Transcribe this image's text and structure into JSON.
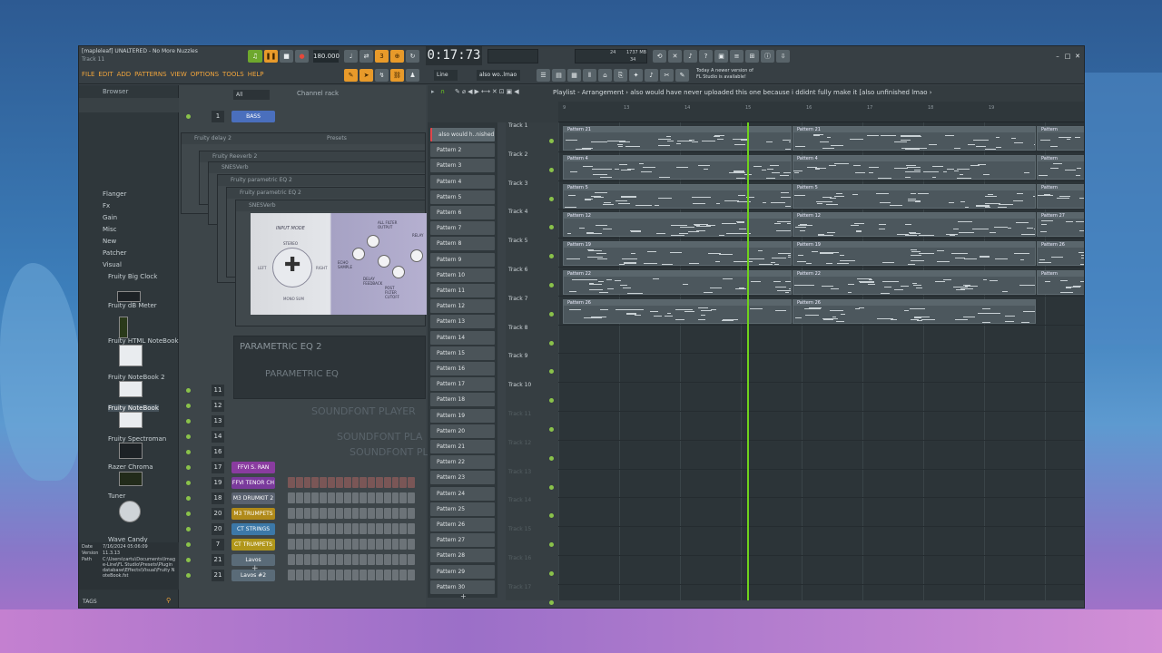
{
  "window": {
    "title": "[mapleleaf] UNALTERED - No More Nuzzles",
    "subtitle": "Track 11"
  },
  "transport": {
    "tempo": "180.000",
    "time": "0:17:73",
    "mem": "1737 MB",
    "cpu": "24",
    "poly": "34"
  },
  "menu": [
    "FILE",
    "EDIT",
    "ADD",
    "PATTERNS",
    "VIEW",
    "OPTIONS",
    "TOOLS",
    "HELP"
  ],
  "toolbar": {
    "snap": "Line",
    "pattern_box": "also wo..lmao"
  },
  "notice": {
    "line1": "Today  A newer version of",
    "line2": "FL Studio is available!"
  },
  "browser": {
    "title": "Browser",
    "tags_label": "TAGS",
    "items": [
      "Flanger",
      "Fx",
      "Gain",
      "Misc",
      "New",
      "Patcher",
      "Visual",
      "Fruity Big Clock",
      "Fruity dB Meter",
      "Fruity HTML NoteBook",
      "Fruity NoteBook 2",
      "Fruity NoteBook",
      "Fruity Spectroman",
      "Razer Chroma",
      "Tuner",
      "Wave Candy"
    ],
    "info": {
      "date_label": "Date",
      "date": "7/16/2024 05:06:09",
      "version_label": "Version",
      "version": "11.3.13",
      "path_label": "Path",
      "path": "C:\\Users\\cartu\\Documents\\Image-Line\\FL Studio\\Presets\\Plugin database\\Effects\\Visual\\Fruity NoteBook.fst"
    }
  },
  "channel_rack": {
    "title": "Channel rack",
    "filter": "All",
    "channels": [
      {
        "num": "1",
        "name": "BASS",
        "color": "#4a6fbd"
      },
      {
        "num": "11",
        "name": "",
        "color": "#55606a"
      },
      {
        "num": "12",
        "name": "",
        "color": "#55606a"
      },
      {
        "num": "13",
        "name": "",
        "color": "#55606a"
      },
      {
        "num": "14",
        "name": "",
        "color": "#55606a"
      },
      {
        "num": "16",
        "name": "",
        "color": "#55606a"
      },
      {
        "num": "17",
        "name": "FFVI S. RAN",
        "color": "#8a3ca0"
      },
      {
        "num": "19",
        "name": "FFVI TENOR CH",
        "color": "#7a3a9c"
      },
      {
        "num": "18",
        "name": "M3 DRUMKIT 2",
        "color": "#5a6270"
      },
      {
        "num": "20",
        "name": "M3 TRUMPETS",
        "color": "#b08a1a"
      },
      {
        "num": "20",
        "name": "CT STRINGS",
        "color": "#3c78a8"
      },
      {
        "num": "7",
        "name": "CT TRUMPETS",
        "color": "#b0961a"
      },
      {
        "num": "21",
        "name": "Lavos",
        "color": "#5a6b78"
      },
      {
        "num": "21",
        "name": "Lavos #2",
        "color": "#5a6b78"
      }
    ]
  },
  "plugins": {
    "delay": "Fruity delay 2",
    "reverb": "Fruity Reeverb 2",
    "snesverb": "SNESVerb",
    "eq1": "Fruity parametric EQ 2",
    "eq2": "Fruity parametric EQ 2",
    "snes2": "SNESVerb",
    "presets": "Presets",
    "input_mode": "INPUT MODE",
    "stereo": "STEREO",
    "left": "LEFT",
    "right": "RIGHT",
    "mono": "MONO SUM",
    "filter_output": "ALL FILTER OUTPUT",
    "echo_sample": "ECHO SAMPLE",
    "delay_feedback": "DELAY FEEDBACK",
    "post_filter": "POST FILTER CUTOFF",
    "relay": "RELAY",
    "peq": "PARAMETRIC EQ 2",
    "peq2": "PARAMETRIC EQ",
    "soundfont": "SOUNDFONT PLAYER",
    "soundfont2": "SOUNDFONT PLA",
    "soundfont3": "SOUNDFONT PL"
  },
  "playlist": {
    "breadcrumb": "Playlist - Arrangement › also would have never uploaded this one because i ddidnt fully make it [also unfinished lmao ›",
    "ruler": [
      "9",
      "13",
      "14",
      "15",
      "16",
      "17",
      "18",
      "19"
    ],
    "patterns": [
      "also would h..nished lmao",
      "Pattern 2",
      "Pattern 3",
      "Pattern 4",
      "Pattern 5",
      "Pattern 6",
      "Pattern 7",
      "Pattern 8",
      "Pattern 9",
      "Pattern 10",
      "Pattern 11",
      "Pattern 12",
      "Pattern 13",
      "Pattern 14",
      "Pattern 15",
      "Pattern 16",
      "Pattern 17",
      "Pattern 18",
      "Pattern 19",
      "Pattern 20",
      "Pattern 21",
      "Pattern 22",
      "Pattern 23",
      "Pattern 24",
      "Pattern 25",
      "Pattern 26",
      "Pattern 27",
      "Pattern 28",
      "Pattern 29",
      "Pattern 30"
    ],
    "tracks": [
      "Track 1",
      "Track 2",
      "Track 3",
      "Track 4",
      "Track 5",
      "Track 6",
      "Track 7",
      "Track 8",
      "Track 9",
      "Track 10",
      "Track 11",
      "Track 12",
      "Track 13",
      "Track 14",
      "Track 15",
      "Track 16",
      "Track 17"
    ],
    "clips": [
      {
        "a": "Pattern 21",
        "b": "Pattern 21",
        "c": "Pattern"
      },
      {
        "a": "Pattern 4",
        "b": "Pattern 4",
        "c": "Pattern"
      },
      {
        "a": "Pattern 5",
        "b": "Pattern 5",
        "c": "Pattern"
      },
      {
        "a": "Pattern 12",
        "b": "Pattern 12",
        "c": "Pattern 27"
      },
      {
        "a": "Pattern 19",
        "b": "Pattern 19",
        "c": "Pattern 26"
      },
      {
        "a": "Pattern 22",
        "b": "Pattern 22",
        "c": "Pattern"
      },
      {
        "a": "Pattern 26",
        "b": "Pattern 26",
        "c": ""
      }
    ]
  }
}
